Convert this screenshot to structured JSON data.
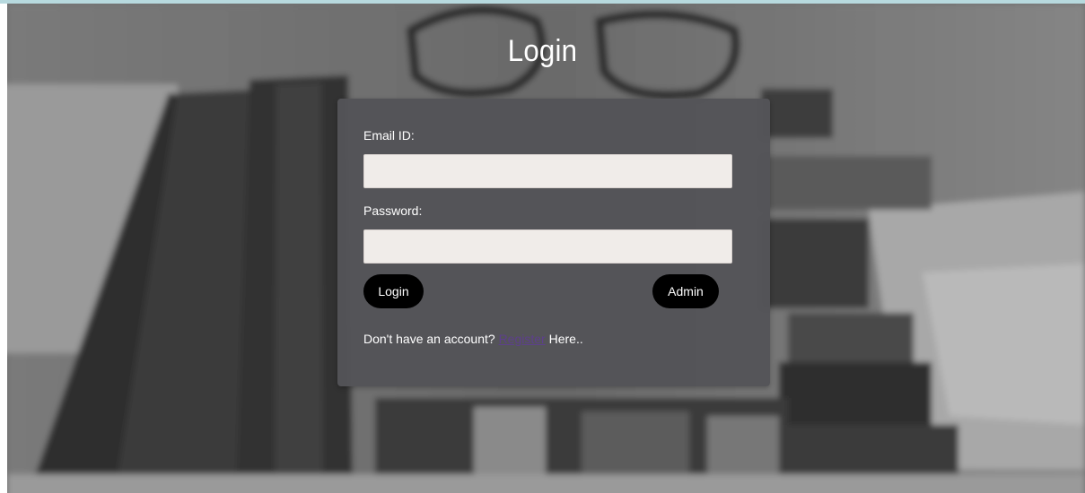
{
  "page": {
    "title": "Login"
  },
  "form": {
    "email_label": "Email ID:",
    "email_value": "",
    "password_label": "Password:",
    "password_value": "",
    "login_button": "Login",
    "admin_button": "Admin"
  },
  "register": {
    "prefix": "Don't have an account?",
    "link_text": "Register",
    "suffix": "Here.."
  },
  "colors": {
    "card_bg": "#545458",
    "field_bg": "#f0ece9",
    "button_bg": "#000000",
    "link": "#5d3f8c",
    "top_strip": "#b7d9de"
  }
}
